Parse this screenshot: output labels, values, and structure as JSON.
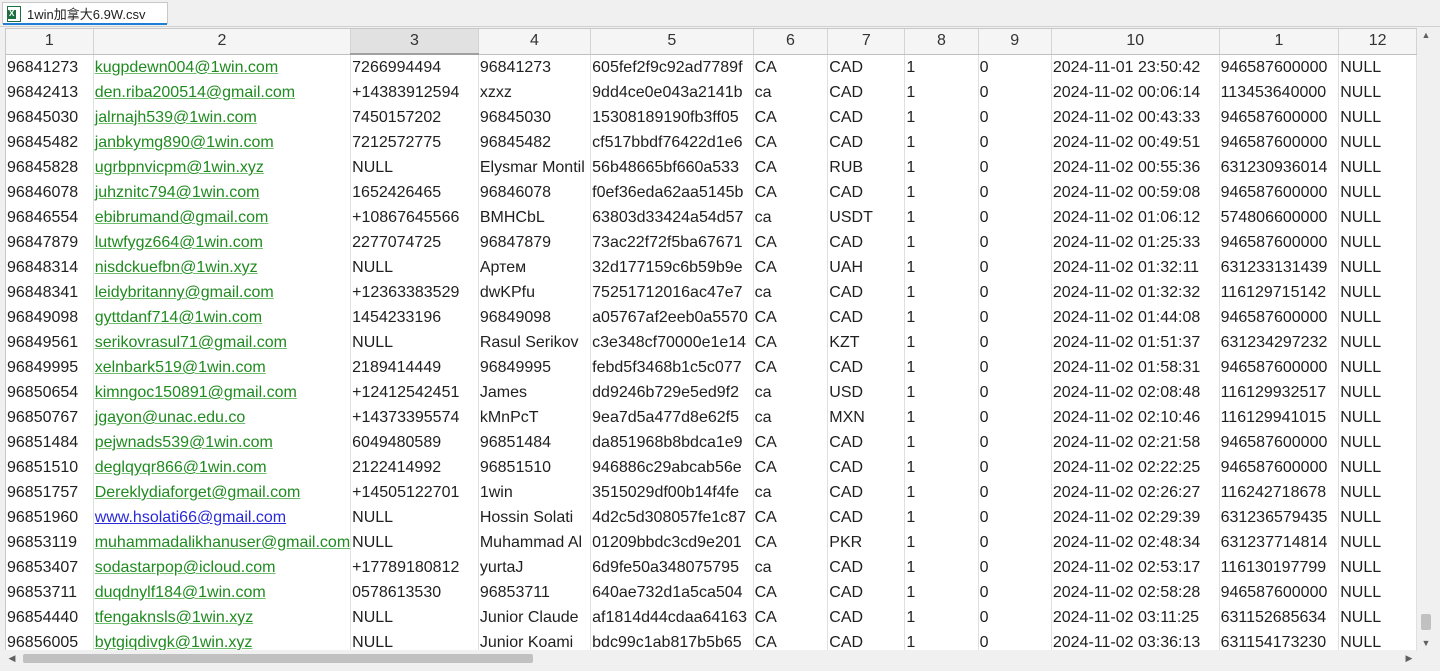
{
  "tab": {
    "title": "1win加拿大6.9W.csv",
    "icon": "excel-file-icon"
  },
  "columns": [
    "1",
    "2",
    "3",
    "4",
    "5",
    "6",
    "7",
    "8",
    "9",
    "10",
    "1",
    "12"
  ],
  "selected_column": "3",
  "rows": [
    [
      "96841273",
      "kugpdewn004@1win.com",
      "7266994494",
      "96841273",
      "605fef2f9c92ad7789f",
      "CA",
      "CAD",
      "1",
      "0",
      "2024-11-01 23:50:42",
      "946587600000",
      "NULL"
    ],
    [
      "96842413",
      "den.riba200514@gmail.com",
      "+14383912594",
      "xzxz",
      "9dd4ce0e043a2141b",
      "ca",
      "CAD",
      "1",
      "0",
      "2024-11-02 00:06:14",
      "113453640000",
      "NULL"
    ],
    [
      "96845030",
      "jalrnajh539@1win.com",
      "7450157202",
      "96845030",
      "15308189190fb3ff05",
      "CA",
      "CAD",
      "1",
      "0",
      "2024-11-02 00:43:33",
      "946587600000",
      "NULL"
    ],
    [
      "96845482",
      "janbkymg890@1win.com",
      "7212572775",
      "96845482",
      "cf517bbdf76422d1e6",
      "CA",
      "CAD",
      "1",
      "0",
      "2024-11-02 00:49:51",
      "946587600000",
      "NULL"
    ],
    [
      "96845828",
      "ugrbpnvicpm@1win.xyz",
      "NULL",
      "Elysmar Montil",
      "56b48665bf660a533",
      "CA",
      "RUB",
      "1",
      "0",
      "2024-11-02 00:55:36",
      "631230936014",
      "NULL"
    ],
    [
      "96846078",
      "juhznitc794@1win.com",
      "1652426465",
      "96846078",
      "f0ef36eda62aa5145b",
      "CA",
      "CAD",
      "1",
      "0",
      "2024-11-02 00:59:08",
      "946587600000",
      "NULL"
    ],
    [
      "96846554",
      "ebibrumand@gmail.com",
      "+10867645566",
      "BMHCbL",
      "63803d33424a54d57",
      "ca",
      "USDT",
      "1",
      "0",
      "2024-11-02 01:06:12",
      "574806600000",
      "NULL"
    ],
    [
      "96847879",
      "lutwfygz664@1win.com",
      "2277074725",
      "96847879",
      "73ac22f72f5ba67671",
      "CA",
      "CAD",
      "1",
      "0",
      "2024-11-02 01:25:33",
      "946587600000",
      "NULL"
    ],
    [
      "96848314",
      "nisdckuefbn@1win.xyz",
      "NULL",
      "Артем",
      "32d177159c6b59b9e",
      "CA",
      "UAH",
      "1",
      "0",
      "2024-11-02 01:32:11",
      "631233131439",
      "NULL"
    ],
    [
      "96848341",
      "leidybritanny@gmail.com",
      "+12363383529",
      "dwKPfu",
      "75251712016ac47e7",
      "ca",
      "CAD",
      "1",
      "0",
      "2024-11-02 01:32:32",
      "116129715142",
      "NULL"
    ],
    [
      "96849098",
      "gyttdanf714@1win.com",
      "1454233196",
      "96849098",
      "a05767af2eeb0a5570",
      "CA",
      "CAD",
      "1",
      "0",
      "2024-11-02 01:44:08",
      "946587600000",
      "NULL"
    ],
    [
      "96849561",
      "serikovrasul71@gmail.com",
      "NULL",
      "Rasul Serikov",
      "c3e348cf70000e1e14",
      "CA",
      "KZT",
      "1",
      "0",
      "2024-11-02 01:51:37",
      "631234297232",
      "NULL"
    ],
    [
      "96849995",
      "xelnbark519@1win.com",
      "2189414449",
      "96849995",
      "febd5f3468b1c5c077",
      "CA",
      "CAD",
      "1",
      "0",
      "2024-11-02 01:58:31",
      "946587600000",
      "NULL"
    ],
    [
      "96850654",
      "kimngoc150891@gmail.com",
      "+12412542451",
      "James",
      "dd9246b729e5ed9f2",
      "ca",
      "USD",
      "1",
      "0",
      "2024-11-02 02:08:48",
      "116129932517",
      "NULL"
    ],
    [
      "96850767",
      "jgayon@unac.edu.co",
      "+14373395574",
      "kMnPcT",
      "9ea7d5a477d8e62f5",
      "ca",
      "MXN",
      "1",
      "0",
      "2024-11-02 02:10:46",
      "116129941015",
      "NULL"
    ],
    [
      "96851484",
      "pejwnads539@1win.com",
      "6049480589",
      "96851484",
      "da851968b8bdca1e9",
      "CA",
      "CAD",
      "1",
      "0",
      "2024-11-02 02:21:58",
      "946587600000",
      "NULL"
    ],
    [
      "96851510",
      "deglqyqr866@1win.com",
      "2122414992",
      "96851510",
      "946886c29abcab56e",
      "CA",
      "CAD",
      "1",
      "0",
      "2024-11-02 02:22:25",
      "946587600000",
      "NULL"
    ],
    [
      "96851757",
      "Dereklydiaforget@gmail.com",
      "+14505122701",
      "1win",
      "3515029df00b14f4fe",
      "ca",
      "CAD",
      "1",
      "0",
      "2024-11-02 02:26:27",
      "116242718678",
      "NULL"
    ],
    [
      "96851960",
      "www.hsolati66@gmail.com",
      "NULL",
      "Hossin Solati",
      "4d2c5d308057fe1c87",
      "CA",
      "CAD",
      "1",
      "0",
      "2024-11-02 02:29:39",
      "631236579435",
      "NULL"
    ],
    [
      "96853119",
      "muhammadalikhanuser@gmail.com",
      "NULL",
      "Muhammad Al",
      "01209bbdc3cd9e201",
      "CA",
      "PKR",
      "1",
      "0",
      "2024-11-02 02:48:34",
      "631237714814",
      "NULL"
    ],
    [
      "96853407",
      "sodastarpop@icloud.com",
      "+17789180812",
      "yurtaJ",
      "6d9fe50a348075795",
      "ca",
      "CAD",
      "1",
      "0",
      "2024-11-02 02:53:17",
      "116130197799",
      "NULL"
    ],
    [
      "96853711",
      "duqdnylf184@1win.com",
      "0578613530",
      "96853711",
      "640ae732d1a5ca504",
      "CA",
      "CAD",
      "1",
      "0",
      "2024-11-02 02:58:28",
      "946587600000",
      "NULL"
    ],
    [
      "96854440",
      "tfengaknsls@1win.xyz",
      "NULL",
      "Junior Claude",
      "af1814d44cdaa64163",
      "CA",
      "CAD",
      "1",
      "0",
      "2024-11-02 03:11:25",
      "631152685634",
      "NULL"
    ],
    [
      "96856005",
      "bytgiqdivgk@1win.xyz",
      "NULL",
      "Junior Koami",
      "bdc99c1ab817b5b65",
      "CA",
      "CAD",
      "1",
      "0",
      "2024-11-02 03:36:13",
      "631154173230",
      "NULL"
    ]
  ],
  "link_email": "www.hsolati66@gmail.com",
  "colors": {
    "email_text": "#1f8a1f",
    "hyperlink_text": "#2a2ad8",
    "tab_accent": "#1f7fd6"
  }
}
